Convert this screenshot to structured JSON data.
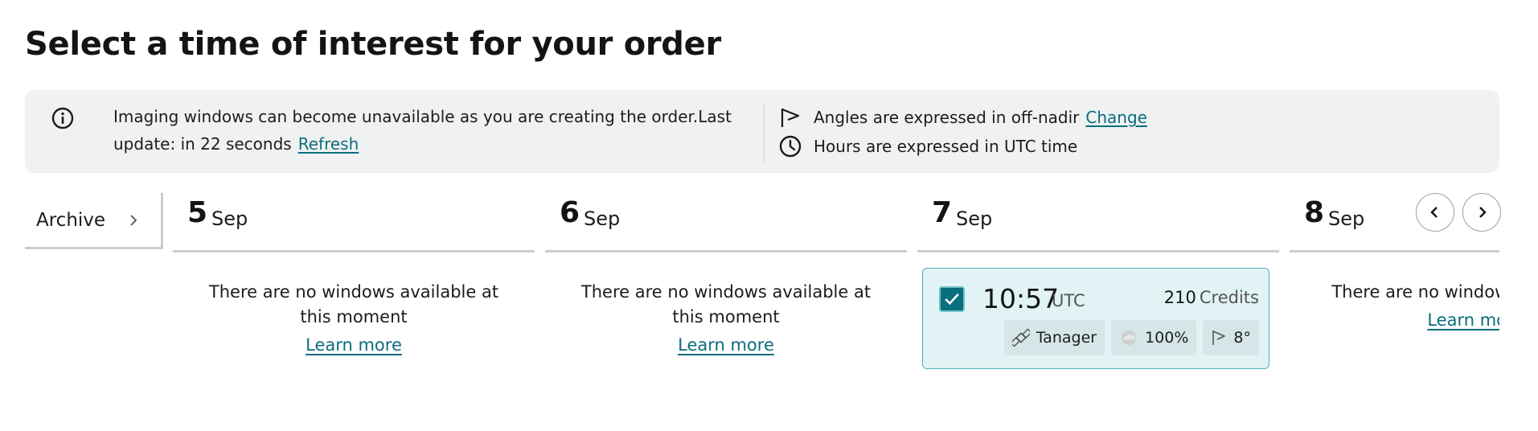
{
  "page": {
    "title": "Select a time of interest for your order"
  },
  "info": {
    "availability_text": "Imaging windows can become unavailable as you are creating the order.Last update: in 22 seconds",
    "refresh_label": "Refresh",
    "angles_text": "Angles are expressed in off-nadir",
    "change_label": "Change",
    "hours_text": "Hours are expressed in UTC time"
  },
  "archive": {
    "label": "Archive"
  },
  "days": [
    {
      "day": "5",
      "month": "Sep",
      "empty_text": "There are no windows available at this moment",
      "learn_more": "Learn more"
    },
    {
      "day": "6",
      "month": "Sep",
      "empty_text": "There are no windows available at this moment",
      "learn_more": "Learn more"
    },
    {
      "day": "7",
      "month": "Sep"
    },
    {
      "day": "8",
      "month": "Sep",
      "empty_text": "There are no windows a moment",
      "learn_more": "Learn mor"
    }
  ],
  "slot": {
    "time": "10:57",
    "tz": "UTC",
    "credits_value": "210",
    "credits_label": "Credits",
    "satellite": "Tanager",
    "cloud": "100%",
    "angle": "8°",
    "selected": true
  },
  "colors": {
    "accent": "#0a6e7d",
    "card_bg": "#e1f3f4",
    "panel_bg": "#f0f1f1"
  }
}
